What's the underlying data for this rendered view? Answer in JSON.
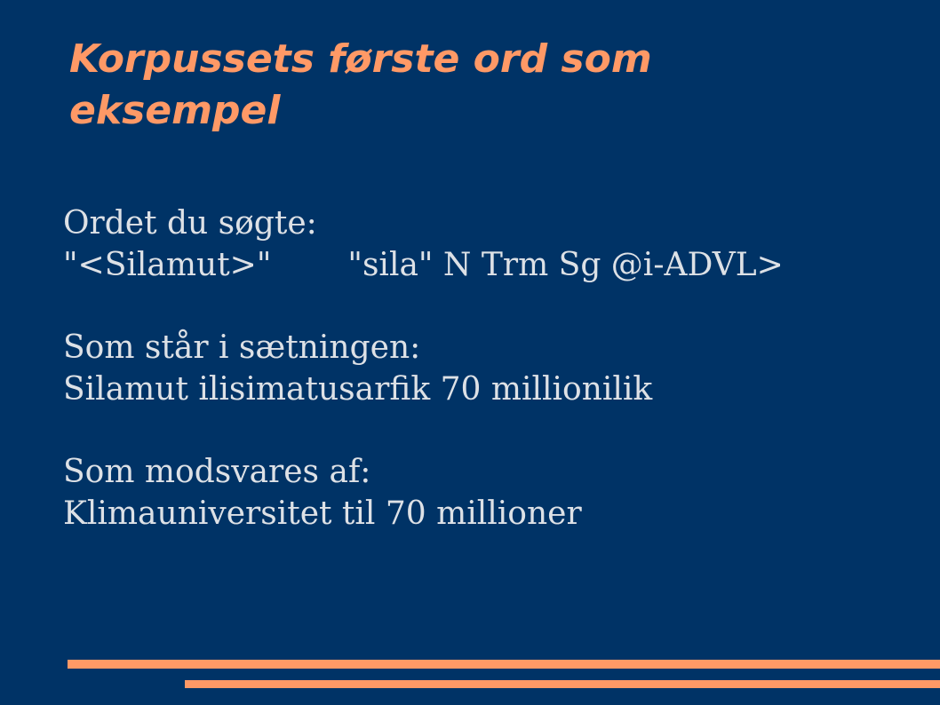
{
  "slide": {
    "title": "Korpussets første ord som eksempel",
    "sections": [
      {
        "label": "Ordet du søgte:",
        "word_form": "\"<Silamut>\"",
        "analysis": "\"sila\" N Trm Sg @i-ADVL>"
      },
      {
        "label": "Som står i sætningen:",
        "text": "Silamut ilisimatusarfik 70 millionilik"
      },
      {
        "label": "Som modsvares af:",
        "text": "Klimauniversitet til 70 millioner"
      }
    ]
  },
  "colors": {
    "background": "#003366",
    "title": "#ff9966",
    "body_text": "#dde1e6",
    "rules": "#ff9966"
  }
}
